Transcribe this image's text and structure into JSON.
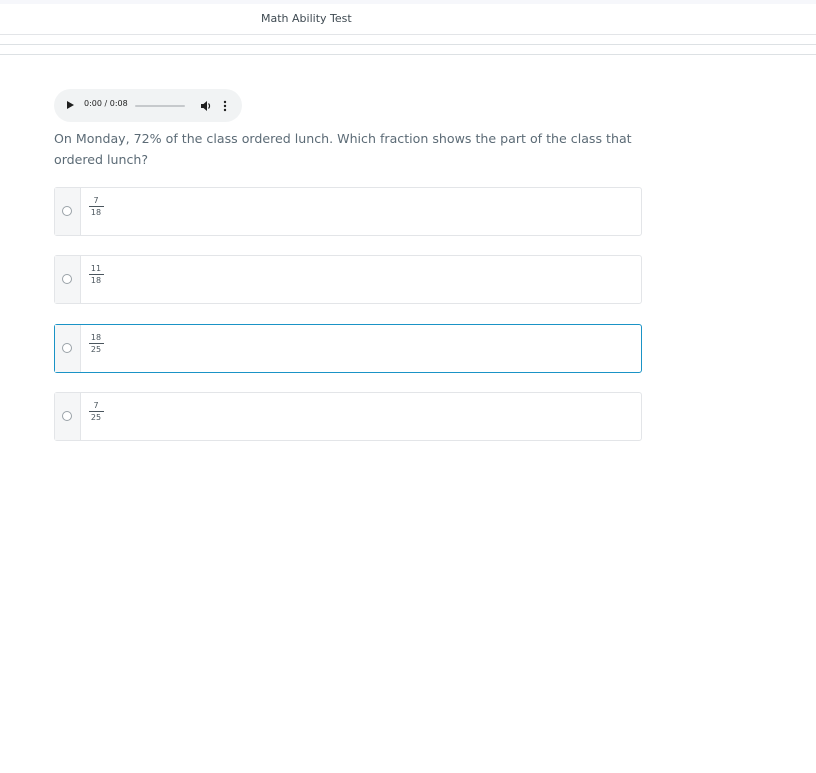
{
  "header": {
    "title": "Math Ability Test"
  },
  "audio": {
    "time": "0:00 / 0:08"
  },
  "question": {
    "text": "On Monday, 72% of the class ordered lunch. Which fraction shows the part of the class that ordered lunch?"
  },
  "options": [
    {
      "numerator": "7",
      "denominator": "18"
    },
    {
      "numerator": "11",
      "denominator": "18"
    },
    {
      "numerator": "18",
      "denominator": "25"
    },
    {
      "numerator": "7",
      "denominator": "25"
    }
  ],
  "colors": {
    "accent": "#1a93c6",
    "question_text": "#5c6b76"
  }
}
